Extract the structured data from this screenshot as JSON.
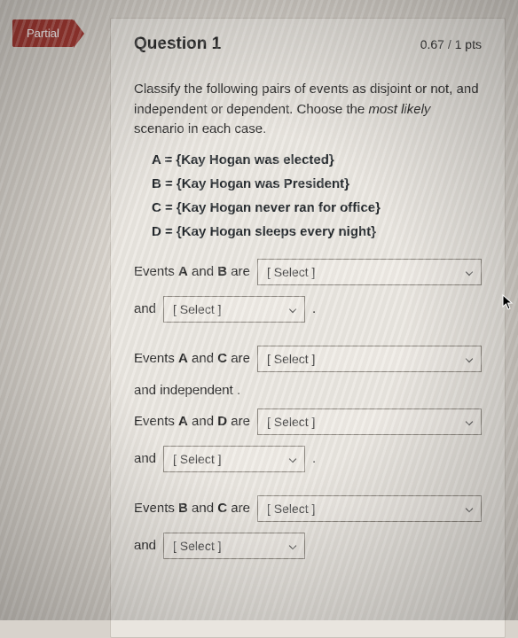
{
  "badge": {
    "label": "Partial",
    "color": "#a43a33"
  },
  "header": {
    "title": "Question 1",
    "points": "0.67 / 1 pts"
  },
  "instructions": {
    "line1": "Classify the following pairs of events as disjoint or not, and independent or dependent.  Choose the ",
    "emph": "most likely",
    "line2": " scenario in each case."
  },
  "definitions": {
    "A": "A = {Kay Hogan was elected}",
    "B": "B = {Kay Hogan was President}",
    "C": "C = {Kay Hogan never ran for office}",
    "D": "D = {Kay Hogan sleeps every night}"
  },
  "labels": {
    "events": "Events ",
    "and_word": " and ",
    "are": " are",
    "and_prefix": "and",
    "period": ".",
    "select_placeholder": "[ Select ]",
    "independent_text": "and independent ."
  },
  "pairs": {
    "AB": {
      "x": "A",
      "y": "B"
    },
    "AC": {
      "x": "A",
      "y": "C"
    },
    "AD": {
      "x": "A",
      "y": "D"
    },
    "BC": {
      "x": "B",
      "y": "C"
    }
  }
}
